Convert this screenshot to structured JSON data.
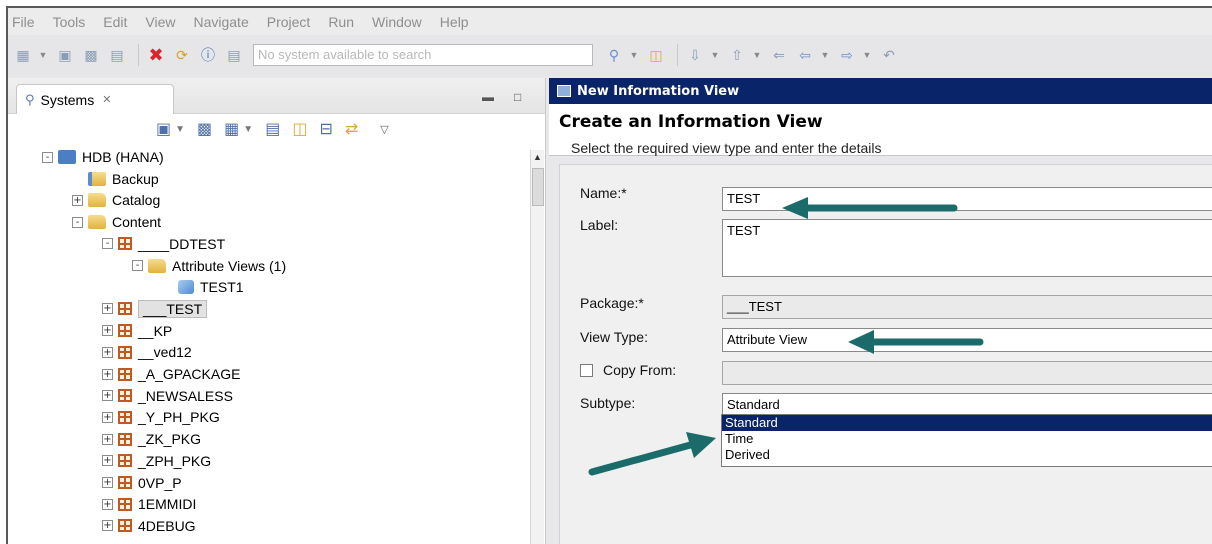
{
  "menu": [
    "File",
    "Tools",
    "Edit",
    "View",
    "Navigate",
    "Project",
    "Run",
    "Window",
    "Help"
  ],
  "toolbar": {
    "search_placeholder": "No system available to search"
  },
  "systems_view": {
    "tab_label": "Systems",
    "tree": [
      {
        "label": "HDB (HANA)",
        "depth": 0,
        "toggle": "-",
        "icon": "database-icon"
      },
      {
        "label": "Backup",
        "depth": 1,
        "toggle": "",
        "icon": "backup-icon"
      },
      {
        "label": "Catalog",
        "depth": 1,
        "toggle": "+",
        "icon": "folder-icon"
      },
      {
        "label": "Content",
        "depth": 1,
        "toggle": "-",
        "icon": "folder-icon"
      },
      {
        "label": "____DDTEST",
        "depth": 2,
        "toggle": "-",
        "icon": "package-icon"
      },
      {
        "label": "Attribute Views (1)",
        "depth": 3,
        "toggle": "-",
        "icon": "folder-icon"
      },
      {
        "label": "TEST1",
        "depth": 4,
        "toggle": "",
        "icon": "attribute-view-icon"
      },
      {
        "label": "___TEST",
        "depth": 2,
        "toggle": "+",
        "icon": "package-icon",
        "selected": true
      },
      {
        "label": "__KP",
        "depth": 2,
        "toggle": "+",
        "icon": "package-icon"
      },
      {
        "label": "__ved12",
        "depth": 2,
        "toggle": "+",
        "icon": "package-icon"
      },
      {
        "label": "_A_GPACKAGE",
        "depth": 2,
        "toggle": "+",
        "icon": "package-icon"
      },
      {
        "label": "_NEWSALESS",
        "depth": 2,
        "toggle": "+",
        "icon": "package-icon"
      },
      {
        "label": "_Y_PH_PKG",
        "depth": 2,
        "toggle": "+",
        "icon": "package-icon"
      },
      {
        "label": "_ZK_PKG",
        "depth": 2,
        "toggle": "+",
        "icon": "package-icon"
      },
      {
        "label": "_ZPH_PKG",
        "depth": 2,
        "toggle": "+",
        "icon": "package-icon"
      },
      {
        "label": "0VP_P",
        "depth": 2,
        "toggle": "+",
        "icon": "package-icon"
      },
      {
        "label": "1EMMIDI",
        "depth": 2,
        "toggle": "+",
        "icon": "package-icon"
      },
      {
        "label": "4DEBUG",
        "depth": 2,
        "toggle": "+",
        "icon": "package-icon"
      }
    ]
  },
  "dialog": {
    "title": "New Information View",
    "heading": "Create an Information View",
    "description": "Select the required view type and enter the details",
    "name_label": "Name:*",
    "name_value": "TEST",
    "label_label": "Label:",
    "label_value": "TEST",
    "package_label": "Package:*",
    "package_value": "___TEST",
    "view_type_label": "View Type:",
    "view_type_value": "Attribute View",
    "copy_from_label": "Copy From:",
    "copy_from_value": "",
    "subtype_label": "Subtype:",
    "subtype_value": "Standard",
    "subtype_options": [
      "Standard",
      "Time",
      "Derived"
    ],
    "subtype_selected_index": 0
  },
  "colors": {
    "dialog_title_bg": "#0a246a",
    "annotation_arrow": "#1c6b6b",
    "package_icon": "#c15a22"
  }
}
